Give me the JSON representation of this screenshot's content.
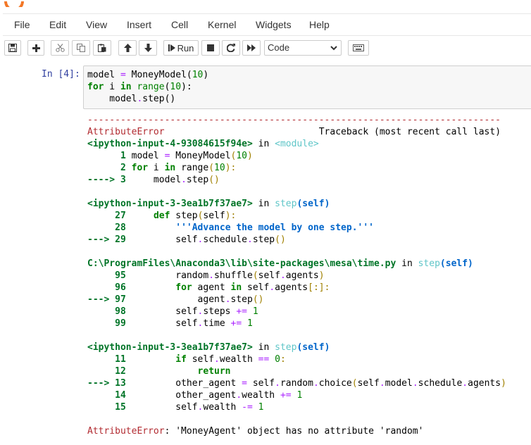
{
  "menu": [
    "File",
    "Edit",
    "View",
    "Insert",
    "Cell",
    "Kernel",
    "Widgets",
    "Help"
  ],
  "toolbar": {
    "run_label": "Run",
    "cell_type": "Code"
  },
  "cell": {
    "prompt": "In [4]:",
    "input_lines": [
      "model = MoneyModel(10)",
      "for i in range(10):",
      "    model.step()"
    ]
  },
  "traceback": {
    "separator": "---------------------------------------------------------------------------",
    "error_name": "AttributeError",
    "header_right": "Traceback (most recent call last)",
    "frame1_file": "<ipython-input-4-93084615f94e>",
    "frame1_in": "in",
    "frame1_func": "<module>",
    "frame1_lines": [
      "      1 model = MoneyModel(10)",
      "      2 for i in range(10):",
      "----> 3     model.step()"
    ],
    "frame2_file": "<ipython-input-3-3ea1b7f37ae7>",
    "frame2_func": "step(self)",
    "frame2_lines": [
      "     27     def step(self):",
      "     28         '''Advance the model by one step.'''",
      "---> 29         self.schedule.step()"
    ],
    "frame3_file": "C:\\ProgramFiles\\Anaconda3\\lib\\site-packages\\mesa\\time.py",
    "frame3_func": "step(self)",
    "frame3_lines": [
      "     95         random.shuffle(self.agents)",
      "     96         for agent in self.agents[:]:",
      "---> 97             agent.step()",
      "     98         self.steps += 1",
      "     99         self.time += 1"
    ],
    "frame4_file": "<ipython-input-3-3ea1b7f37ae7>",
    "frame4_func": "step(self)",
    "frame4_lines": [
      "     11         if self.wealth == 0:",
      "     12             return",
      "---> 13         other_agent = self.random.choice(self.model.schedule.agents)",
      "     14         other_agent.wealth += 1",
      "     15         self.wealth -= 1"
    ],
    "final_error": "AttributeError: 'MoneyAgent' object has no attribute 'random'"
  }
}
